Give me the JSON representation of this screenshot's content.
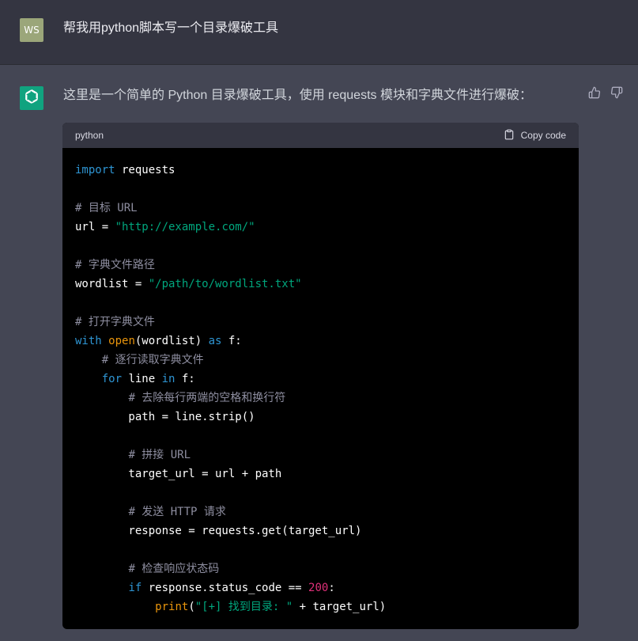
{
  "user": {
    "avatar_text": "WS",
    "avatar_color": "#9ba67a",
    "message": "帮我用python脚本写一个目录爆破工具"
  },
  "assistant": {
    "avatar_color": "#10a37f",
    "avatar_icon": "openai-logo-icon",
    "message": "这里是一个简单的 Python 目录爆破工具，使用 requests 模块和字典文件进行爆破：",
    "feedback": {
      "thumbs_up_icon": "thumbs-up-icon",
      "thumbs_down_icon": "thumbs-down-icon"
    }
  },
  "code_block": {
    "language": "python",
    "copy_label": "Copy code",
    "lines": [
      [
        {
          "t": "kw",
          "v": "import"
        },
        {
          "t": "plain",
          "v": " requests"
        }
      ],
      [],
      [
        {
          "t": "com",
          "v": "# 目标 URL"
        }
      ],
      [
        {
          "t": "plain",
          "v": "url = "
        },
        {
          "t": "str",
          "v": "\"http://example.com/\""
        }
      ],
      [],
      [
        {
          "t": "com",
          "v": "# 字典文件路径"
        }
      ],
      [
        {
          "t": "plain",
          "v": "wordlist = "
        },
        {
          "t": "str",
          "v": "\"/path/to/wordlist.txt\""
        }
      ],
      [],
      [
        {
          "t": "com",
          "v": "# 打开字典文件"
        }
      ],
      [
        {
          "t": "kw",
          "v": "with"
        },
        {
          "t": "plain",
          "v": " "
        },
        {
          "t": "builtin",
          "v": "open"
        },
        {
          "t": "plain",
          "v": "(wordlist) "
        },
        {
          "t": "kw",
          "v": "as"
        },
        {
          "t": "plain",
          "v": " f:"
        }
      ],
      [
        {
          "t": "plain",
          "v": "    "
        },
        {
          "t": "com",
          "v": "# 逐行读取字典文件"
        }
      ],
      [
        {
          "t": "plain",
          "v": "    "
        },
        {
          "t": "kw",
          "v": "for"
        },
        {
          "t": "plain",
          "v": " line "
        },
        {
          "t": "kw",
          "v": "in"
        },
        {
          "t": "plain",
          "v": " f:"
        }
      ],
      [
        {
          "t": "plain",
          "v": "        "
        },
        {
          "t": "com",
          "v": "# 去除每行两端的空格和换行符"
        }
      ],
      [
        {
          "t": "plain",
          "v": "        path = line.strip()"
        }
      ],
      [],
      [
        {
          "t": "plain",
          "v": "        "
        },
        {
          "t": "com",
          "v": "# 拼接 URL"
        }
      ],
      [
        {
          "t": "plain",
          "v": "        target_url = url + path"
        }
      ],
      [],
      [
        {
          "t": "plain",
          "v": "        "
        },
        {
          "t": "com",
          "v": "# 发送 HTTP 请求"
        }
      ],
      [
        {
          "t": "plain",
          "v": "        response = requests.get(target_url)"
        }
      ],
      [],
      [
        {
          "t": "plain",
          "v": "        "
        },
        {
          "t": "com",
          "v": "# 检查响应状态码"
        }
      ],
      [
        {
          "t": "plain",
          "v": "        "
        },
        {
          "t": "kw",
          "v": "if"
        },
        {
          "t": "plain",
          "v": " response.status_code == "
        },
        {
          "t": "num",
          "v": "200"
        },
        {
          "t": "plain",
          "v": ":"
        }
      ],
      [
        {
          "t": "plain",
          "v": "            "
        },
        {
          "t": "builtin",
          "v": "print"
        },
        {
          "t": "plain",
          "v": "("
        },
        {
          "t": "str",
          "v": "\"[+] 找到目录: \""
        },
        {
          "t": "plain",
          "v": " + target_url)"
        }
      ]
    ]
  }
}
